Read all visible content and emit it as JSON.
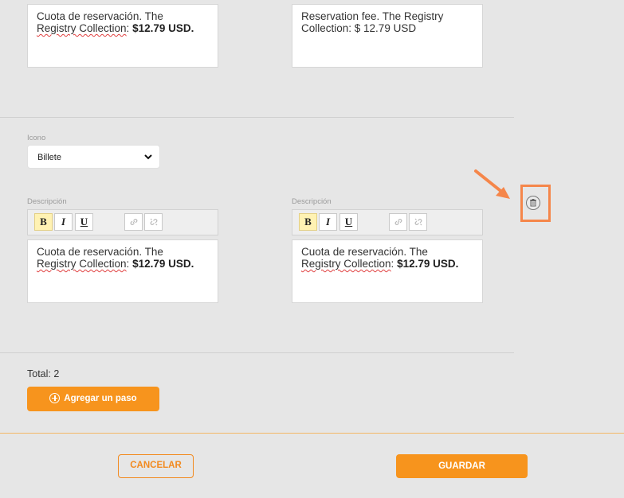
{
  "step1": {
    "desc_es": {
      "line1": "Cuota de reservación. The",
      "link": "Registry Collection",
      "sep": ": ",
      "price": "$12.79 USD."
    },
    "desc_en": {
      "line1": "Reservation fee. The Registry",
      "line2": "Collection: $ 12.79 USD"
    }
  },
  "step2": {
    "icon_label": "Icono",
    "icon_select_value": "Billete",
    "desc_label_left": "Descripción",
    "desc_label_right": "Descripción",
    "toolbar": {
      "bold": "B",
      "italic": "I",
      "underline": "U"
    },
    "desc_es": {
      "line1": "Cuota de reservación. The",
      "link": "Registry Collection",
      "sep": ": ",
      "price": "$12.79 USD."
    },
    "desc_other": {
      "line1": "Cuota de reservación. The",
      "link": "Registry Collection",
      "sep": ": ",
      "price": "$12.79 USD."
    }
  },
  "total_label": "Total: 2",
  "add_step_label": "Agregar un paso",
  "cancel_label": "CANCELAR",
  "save_label": "GUARDAR",
  "colors": {
    "accent": "#f7941d",
    "highlight": "#f5864a"
  },
  "icons": {
    "delete": "trash-icon",
    "link": "link-icon",
    "unlink": "unlink-icon",
    "add": "plus-circle-icon",
    "dropdown": "chevron-down-icon"
  }
}
